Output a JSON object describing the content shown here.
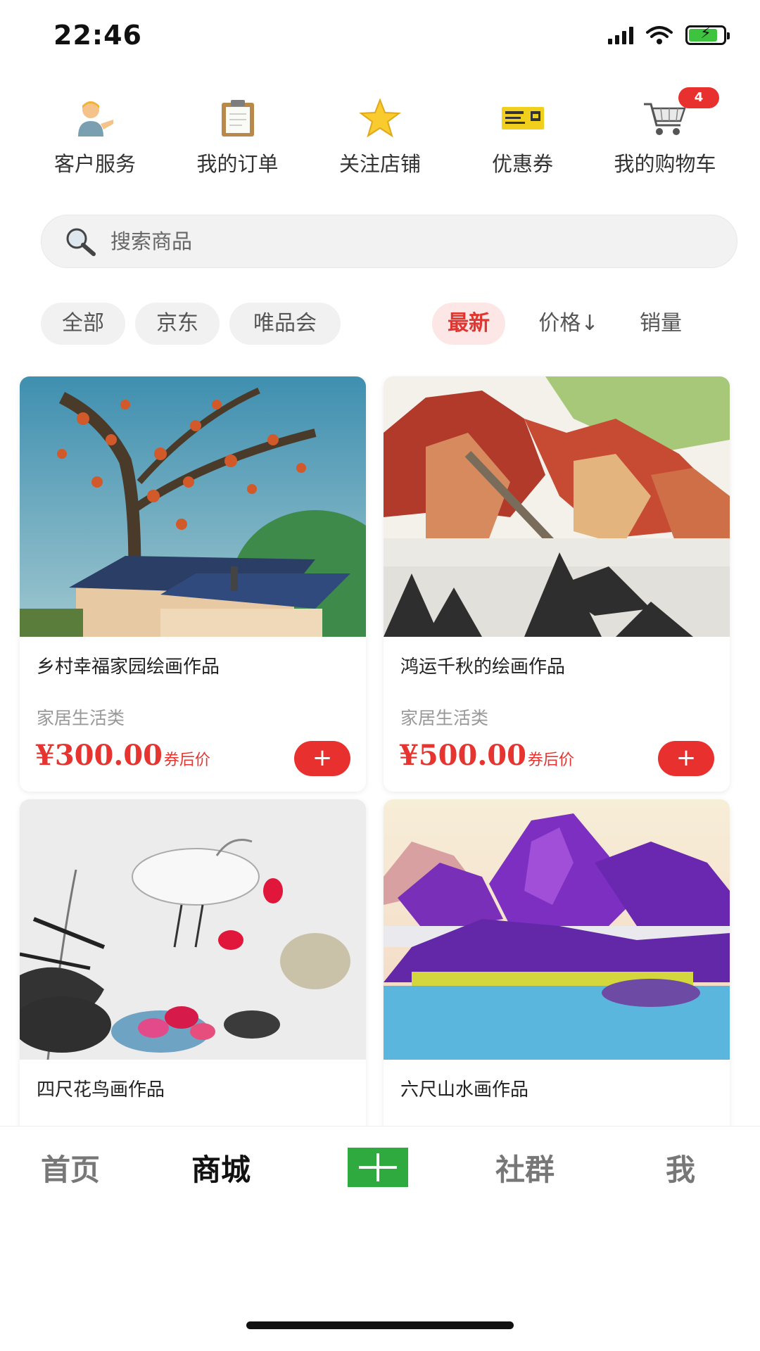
{
  "status_bar": {
    "time": "22:46"
  },
  "quick_menu": [
    {
      "label": "客户服务",
      "icon": "customer-service-icon"
    },
    {
      "label": "我的订单",
      "icon": "clipboard-icon"
    },
    {
      "label": "关注店铺",
      "icon": "star-icon"
    },
    {
      "label": "优惠券",
      "icon": "coupon-icon"
    },
    {
      "label": "我的购物车",
      "icon": "cart-icon",
      "badge": "4"
    }
  ],
  "search": {
    "placeholder": "搜索商品"
  },
  "filters": {
    "chips": [
      "全部",
      "京东",
      "唯品会"
    ],
    "sorts": {
      "newest": "最新",
      "price": "价格↓",
      "sales": "销量"
    }
  },
  "products": [
    {
      "name": "乡村幸福家园绘画作品",
      "category": "家居生活类",
      "price": "¥300.00",
      "price_suffix": "券后价",
      "add": "+"
    },
    {
      "name": "鸿运千秋的绘画作品",
      "category": "家居生活类",
      "price": "¥500.00",
      "price_suffix": "券后价",
      "add": "+"
    },
    {
      "name": "四尺花鸟画作品"
    },
    {
      "name": "六尺山水画作品"
    }
  ],
  "tabbar": {
    "home": "首页",
    "mall": "商城",
    "community": "社群",
    "me": "我"
  },
  "colors": {
    "accent": "#e8312e",
    "plus_green": "#2eaa3f"
  }
}
